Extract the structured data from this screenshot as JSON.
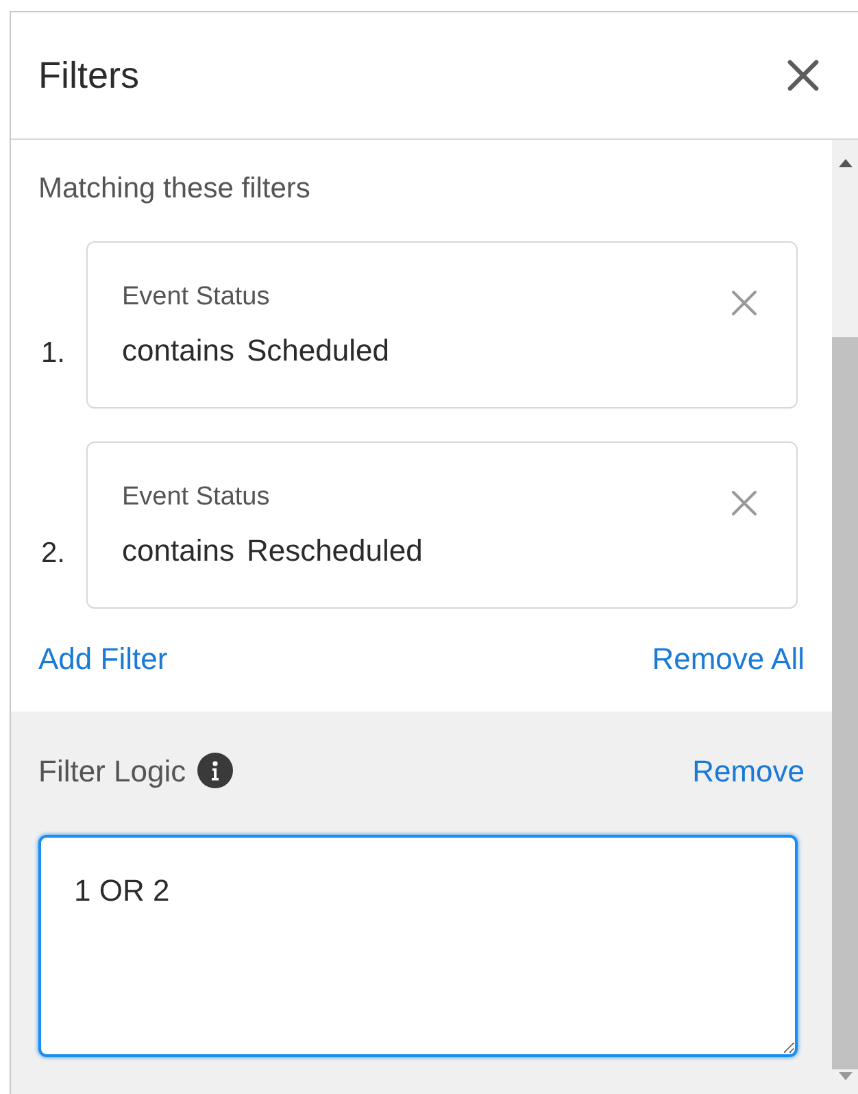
{
  "panel": {
    "title": "Filters"
  },
  "section_label": "Matching these filters",
  "filters": [
    {
      "number": "1.",
      "field": "Event Status",
      "operator": "contains",
      "value": "Scheduled"
    },
    {
      "number": "2.",
      "field": "Event Status",
      "operator": "contains",
      "value": "Rescheduled"
    }
  ],
  "actions": [
    "Add Filter",
    "Remove All"
  ],
  "filter_logic": {
    "label": "Filter Logic",
    "remove": "Remove",
    "value": "1 OR 2",
    "focused": true
  }
}
